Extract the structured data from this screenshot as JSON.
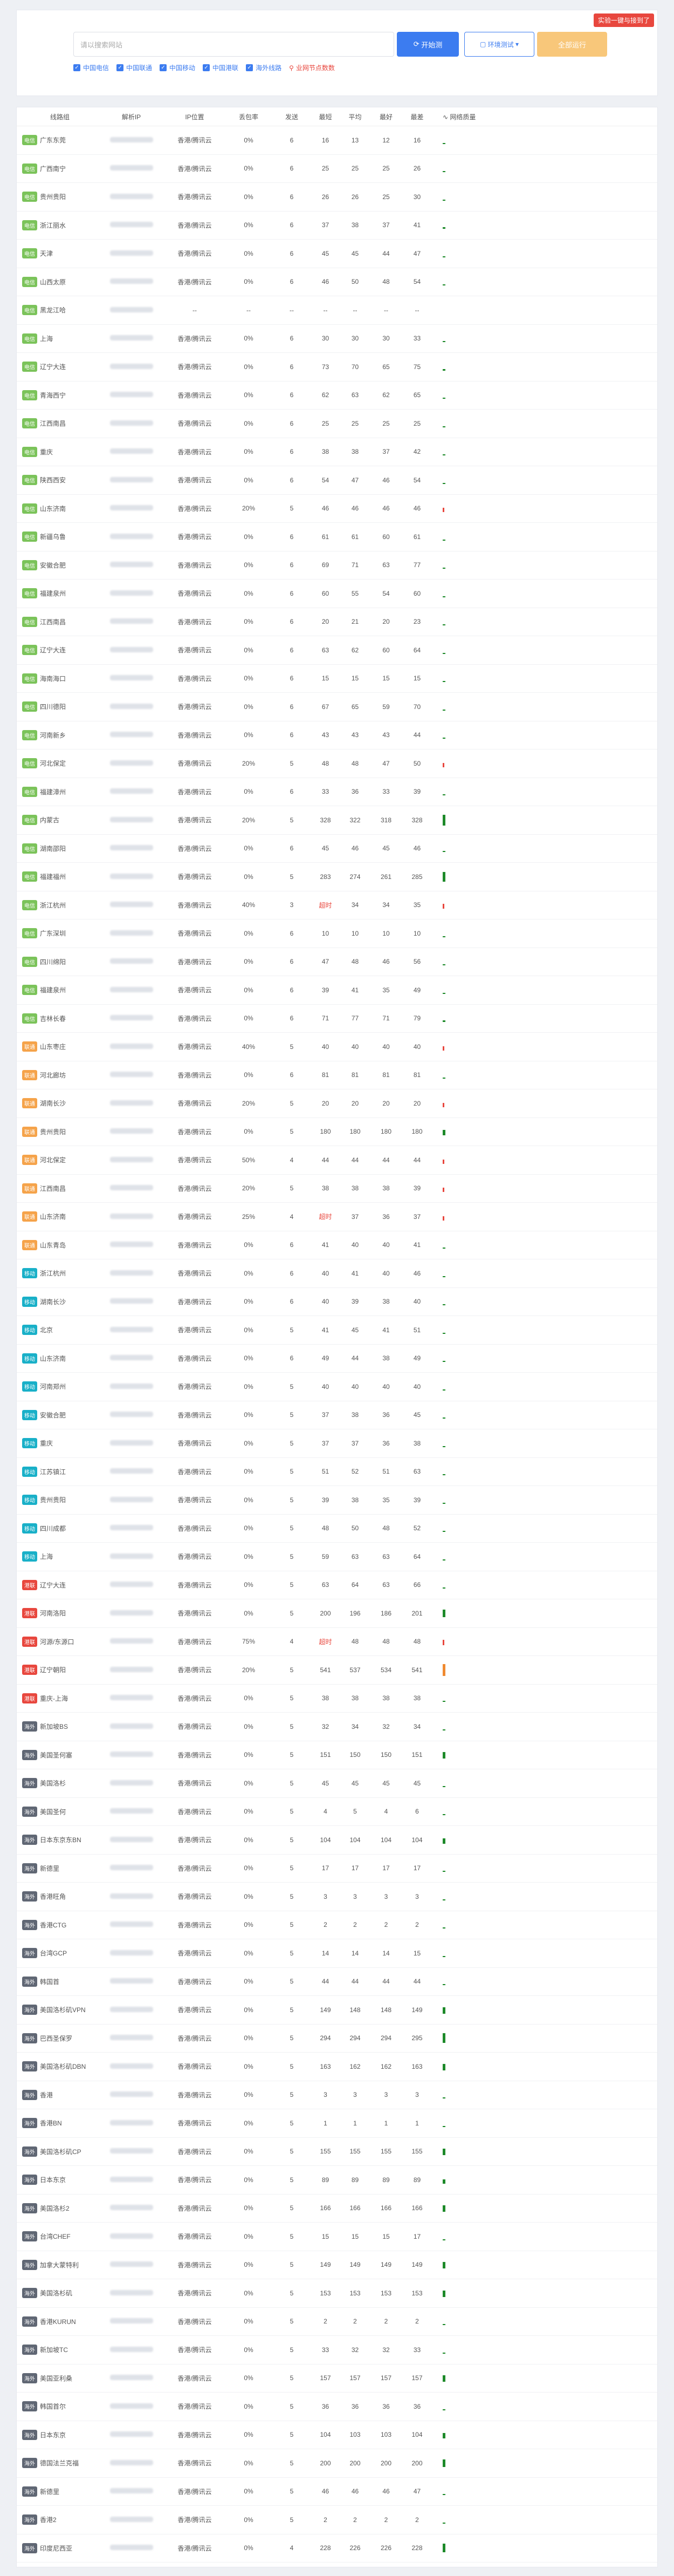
{
  "header": {
    "corner_badge": "实验一键与接到了",
    "search_placeholder": "请以搜索网站",
    "start_btn": "开始测",
    "env_btn": "环境测试",
    "stop_btn": "全部运行"
  },
  "filters": [
    "中国电信",
    "中国联通",
    "中国移动",
    "中国港联",
    "海外线路"
  ],
  "location_filter": "业网节点数数",
  "columns": [
    "线路组",
    "解析IP",
    "IP位置",
    "丢包率",
    "发送",
    "最短",
    "平均",
    "最好",
    "最差",
    "网络质量"
  ],
  "colors": {
    "green": "#7bc35a",
    "orange": "#f5a34a",
    "teal": "#19b0c8",
    "red": "#e8473e",
    "gray": "#606774"
  },
  "rows": [
    {
      "tag": "电信",
      "tc": "green",
      "name": "广东东莞",
      "loss": "0%",
      "s": "6",
      "a": "16",
      "b": "13",
      "c": "12",
      "d": "16",
      "q": 1
    },
    {
      "tag": "电信",
      "tc": "green",
      "name": "广西南宁",
      "loss": "0%",
      "s": "6",
      "a": "25",
      "b": "25",
      "c": "25",
      "d": "26",
      "q": 1
    },
    {
      "tag": "电信",
      "tc": "green",
      "name": "贵州贵阳",
      "loss": "0%",
      "s": "6",
      "a": "26",
      "b": "26",
      "c": "25",
      "d": "30",
      "q": 1
    },
    {
      "tag": "电信",
      "tc": "green",
      "name": "浙江丽水",
      "loss": "0%",
      "s": "6",
      "a": "37",
      "b": "38",
      "c": "37",
      "d": "41",
      "q": 3
    },
    {
      "tag": "电信",
      "tc": "green",
      "name": "天津",
      "loss": "0%",
      "s": "6",
      "a": "45",
      "b": "45",
      "c": "44",
      "d": "47",
      "q": 2
    },
    {
      "tag": "电信",
      "tc": "green",
      "name": "山西太原",
      "loss": "0%",
      "s": "6",
      "a": "46",
      "b": "50",
      "c": "48",
      "d": "54",
      "q": 2
    },
    {
      "tag": "电信",
      "tc": "green",
      "name": "黑龙江哈",
      "loss": "--",
      "s": "--",
      "a": "--",
      "b": "--",
      "c": "--",
      "d": "--",
      "q": 0
    },
    {
      "tag": "电信",
      "tc": "green",
      "name": "上海",
      "loss": "0%",
      "s": "6",
      "a": "30",
      "b": "30",
      "c": "30",
      "d": "33",
      "q": 1
    },
    {
      "tag": "电信",
      "tc": "green",
      "name": "辽宁大连",
      "loss": "0%",
      "s": "6",
      "a": "73",
      "b": "70",
      "c": "65",
      "d": "75",
      "q": 3
    },
    {
      "tag": "电信",
      "tc": "green",
      "name": "青海西宁",
      "loss": "0%",
      "s": "6",
      "a": "62",
      "b": "63",
      "c": "62",
      "d": "65",
      "q": 2
    },
    {
      "tag": "电信",
      "tc": "green",
      "name": "江西南昌",
      "loss": "0%",
      "s": "6",
      "a": "25",
      "b": "25",
      "c": "25",
      "d": "25",
      "q": 1
    },
    {
      "tag": "电信",
      "tc": "green",
      "name": "重庆",
      "loss": "0%",
      "s": "6",
      "a": "38",
      "b": "38",
      "c": "37",
      "d": "42",
      "q": 1
    },
    {
      "tag": "电信",
      "tc": "green",
      "name": "陕西西安",
      "loss": "0%",
      "s": "6",
      "a": "54",
      "b": "47",
      "c": "46",
      "d": "54",
      "q": 2
    },
    {
      "tag": "电信",
      "tc": "green",
      "name": "山东济南",
      "loss": "20%",
      "s": "5",
      "a": "46",
      "b": "46",
      "c": "46",
      "d": "46",
      "q": 8
    },
    {
      "tag": "电信",
      "tc": "green",
      "name": "新疆乌鲁",
      "loss": "0%",
      "s": "6",
      "a": "61",
      "b": "61",
      "c": "60",
      "d": "61",
      "q": 2
    },
    {
      "tag": "电信",
      "tc": "green",
      "name": "安徽合肥",
      "loss": "0%",
      "s": "6",
      "a": "69",
      "b": "71",
      "c": "63",
      "d": "77",
      "q": 2
    },
    {
      "tag": "电信",
      "tc": "green",
      "name": "福建泉州",
      "loss": "0%",
      "s": "6",
      "a": "60",
      "b": "55",
      "c": "54",
      "d": "60",
      "q": 1
    },
    {
      "tag": "电信",
      "tc": "green",
      "name": "江西南昌",
      "loss": "0%",
      "s": "6",
      "a": "20",
      "b": "21",
      "c": "20",
      "d": "23",
      "q": 1
    },
    {
      "tag": "电信",
      "tc": "green",
      "name": "辽宁大连",
      "loss": "0%",
      "s": "6",
      "a": "63",
      "b": "62",
      "c": "60",
      "d": "64",
      "q": 1
    },
    {
      "tag": "电信",
      "tc": "green",
      "name": "海南海口",
      "loss": "0%",
      "s": "6",
      "a": "15",
      "b": "15",
      "c": "15",
      "d": "15",
      "q": 1
    },
    {
      "tag": "电信",
      "tc": "green",
      "name": "四川德阳",
      "loss": "0%",
      "s": "6",
      "a": "67",
      "b": "65",
      "c": "59",
      "d": "70",
      "q": 2
    },
    {
      "tag": "电信",
      "tc": "green",
      "name": "河南新乡",
      "loss": "0%",
      "s": "6",
      "a": "43",
      "b": "43",
      "c": "43",
      "d": "44",
      "q": 1
    },
    {
      "tag": "电信",
      "tc": "green",
      "name": "河北保定",
      "loss": "20%",
      "s": "5",
      "a": "48",
      "b": "48",
      "c": "47",
      "d": "50",
      "q": 8
    },
    {
      "tag": "电信",
      "tc": "green",
      "name": "福建漳州",
      "loss": "0%",
      "s": "6",
      "a": "33",
      "b": "36",
      "c": "33",
      "d": "39",
      "q": 1
    },
    {
      "tag": "电信",
      "tc": "green",
      "name": "内蒙古",
      "loss": "20%",
      "s": "5",
      "a": "328",
      "b": "322",
      "c": "318",
      "d": "328",
      "q": 20
    },
    {
      "tag": "电信",
      "tc": "green",
      "name": "湖南邵阳",
      "loss": "0%",
      "s": "6",
      "a": "45",
      "b": "46",
      "c": "45",
      "d": "46",
      "q": 1
    },
    {
      "tag": "电信",
      "tc": "green",
      "name": "福建福州",
      "loss": "0%",
      "s": "5",
      "a": "283",
      "b": "274",
      "c": "261",
      "d": "285",
      "q": 18
    },
    {
      "tag": "电信",
      "tc": "green",
      "name": "浙江杭州",
      "loss": "40%",
      "s": "3",
      "a": "超时",
      "b": "34",
      "c": "34",
      "d": "35",
      "q": 9,
      "to": true
    },
    {
      "tag": "电信",
      "tc": "green",
      "name": "广东深圳",
      "loss": "0%",
      "s": "6",
      "a": "10",
      "b": "10",
      "c": "10",
      "d": "10",
      "q": 1
    },
    {
      "tag": "电信",
      "tc": "green",
      "name": "四川绵阳",
      "loss": "0%",
      "s": "6",
      "a": "47",
      "b": "48",
      "c": "46",
      "d": "56",
      "q": 2
    },
    {
      "tag": "电信",
      "tc": "green",
      "name": "福建泉州",
      "loss": "0%",
      "s": "6",
      "a": "39",
      "b": "41",
      "c": "35",
      "d": "49",
      "q": 2
    },
    {
      "tag": "电信",
      "tc": "green",
      "name": "吉林长春",
      "loss": "0%",
      "s": "6",
      "a": "71",
      "b": "77",
      "c": "71",
      "d": "79",
      "q": 3
    },
    {
      "tag": "联通",
      "tc": "orange",
      "name": "山东枣庄",
      "loss": "40%",
      "s": "5",
      "a": "40",
      "b": "40",
      "c": "40",
      "d": "40",
      "q": 8
    },
    {
      "tag": "联通",
      "tc": "orange",
      "name": "河北廊坊",
      "loss": "0%",
      "s": "6",
      "a": "81",
      "b": "81",
      "c": "81",
      "d": "81",
      "q": 2
    },
    {
      "tag": "联通",
      "tc": "orange",
      "name": "湖南长沙",
      "loss": "20%",
      "s": "5",
      "a": "20",
      "b": "20",
      "c": "20",
      "d": "20",
      "q": 8
    },
    {
      "tag": "联通",
      "tc": "orange",
      "name": "贵州贵阳",
      "loss": "0%",
      "s": "5",
      "a": "180",
      "b": "180",
      "c": "180",
      "d": "180",
      "q": 10
    },
    {
      "tag": "联通",
      "tc": "orange",
      "name": "河北保定",
      "loss": "50%",
      "s": "4",
      "a": "44",
      "b": "44",
      "c": "44",
      "d": "44",
      "q": 8
    },
    {
      "tag": "联通",
      "tc": "orange",
      "name": "江西南昌",
      "loss": "20%",
      "s": "5",
      "a": "38",
      "b": "38",
      "c": "38",
      "d": "39",
      "q": 8
    },
    {
      "tag": "联通",
      "tc": "orange",
      "name": "山东济南",
      "loss": "25%",
      "s": "4",
      "a": "超时",
      "b": "37",
      "c": "36",
      "d": "37",
      "q": 8,
      "to": true
    },
    {
      "tag": "联通",
      "tc": "orange",
      "name": "山东青岛",
      "loss": "0%",
      "s": "6",
      "a": "41",
      "b": "40",
      "c": "40",
      "d": "41",
      "q": 1
    },
    {
      "tag": "移动",
      "tc": "teal",
      "name": "浙江杭州",
      "loss": "0%",
      "s": "6",
      "a": "40",
      "b": "41",
      "c": "40",
      "d": "46",
      "q": 2
    },
    {
      "tag": "移动",
      "tc": "teal",
      "name": "湖南长沙",
      "loss": "0%",
      "s": "6",
      "a": "40",
      "b": "39",
      "c": "38",
      "d": "40",
      "q": 1
    },
    {
      "tag": "移动",
      "tc": "teal",
      "name": "北京",
      "loss": "0%",
      "s": "5",
      "a": "41",
      "b": "45",
      "c": "41",
      "d": "51",
      "q": 2
    },
    {
      "tag": "移动",
      "tc": "teal",
      "name": "山东济南",
      "loss": "0%",
      "s": "6",
      "a": "49",
      "b": "44",
      "c": "38",
      "d": "49",
      "q": 2
    },
    {
      "tag": "移动",
      "tc": "teal",
      "name": "河南郑州",
      "loss": "0%",
      "s": "5",
      "a": "40",
      "b": "40",
      "c": "40",
      "d": "40",
      "q": 1
    },
    {
      "tag": "移动",
      "tc": "teal",
      "name": "安徽合肥",
      "loss": "0%",
      "s": "5",
      "a": "37",
      "b": "38",
      "c": "36",
      "d": "45",
      "q": 2
    },
    {
      "tag": "移动",
      "tc": "teal",
      "name": "重庆",
      "loss": "0%",
      "s": "5",
      "a": "37",
      "b": "37",
      "c": "36",
      "d": "38",
      "q": 1
    },
    {
      "tag": "移动",
      "tc": "teal",
      "name": "江苏镇江",
      "loss": "0%",
      "s": "5",
      "a": "51",
      "b": "52",
      "c": "51",
      "d": "63",
      "q": 2
    },
    {
      "tag": "移动",
      "tc": "teal",
      "name": "贵州贵阳",
      "loss": "0%",
      "s": "5",
      "a": "39",
      "b": "38",
      "c": "35",
      "d": "39",
      "q": 1
    },
    {
      "tag": "移动",
      "tc": "teal",
      "name": "四川成都",
      "loss": "0%",
      "s": "5",
      "a": "48",
      "b": "50",
      "c": "48",
      "d": "52",
      "q": 2
    },
    {
      "tag": "移动",
      "tc": "teal",
      "name": "上海",
      "loss": "0%",
      "s": "5",
      "a": "59",
      "b": "63",
      "c": "63",
      "d": "64",
      "q": 2
    },
    {
      "tag": "港联",
      "tc": "red",
      "name": "辽宁大连",
      "loss": "0%",
      "s": "5",
      "a": "63",
      "b": "64",
      "c": "63",
      "d": "66",
      "q": 2
    },
    {
      "tag": "港联",
      "tc": "red",
      "name": "河南洛阳",
      "loss": "0%",
      "s": "5",
      "a": "200",
      "b": "196",
      "c": "186",
      "d": "201",
      "q": 14
    },
    {
      "tag": "港联",
      "tc": "red",
      "name": "河源/东源口",
      "loss": "75%",
      "s": "4",
      "a": "超时",
      "b": "48",
      "c": "48",
      "d": "48",
      "q": 10,
      "to": true
    },
    {
      "tag": "港联",
      "tc": "red",
      "name": "辽宁朝阳",
      "loss": "20%",
      "s": "5",
      "a": "541",
      "b": "537",
      "c": "534",
      "d": "541",
      "q": 22,
      "orange": true
    },
    {
      "tag": "港联",
      "tc": "red",
      "name": "重庆-上海",
      "loss": "0%",
      "s": "5",
      "a": "38",
      "b": "38",
      "c": "38",
      "d": "38",
      "q": 1
    },
    {
      "tag": "海外",
      "tc": "gray",
      "name": "新加坡BS",
      "loss": "0%",
      "s": "5",
      "a": "32",
      "b": "34",
      "c": "32",
      "d": "34",
      "q": 1
    },
    {
      "tag": "海外",
      "tc": "gray",
      "name": "美国圣何塞",
      "loss": "0%",
      "s": "5",
      "a": "151",
      "b": "150",
      "c": "150",
      "d": "151",
      "q": 12
    },
    {
      "tag": "海外",
      "tc": "gray",
      "name": "美国洛杉",
      "loss": "0%",
      "s": "5",
      "a": "45",
      "b": "45",
      "c": "45",
      "d": "45",
      "q": 2
    },
    {
      "tag": "海外",
      "tc": "gray",
      "name": "美国圣何",
      "loss": "0%",
      "s": "5",
      "a": "4",
      "b": "5",
      "c": "4",
      "d": "6",
      "q": 1
    },
    {
      "tag": "海外",
      "tc": "gray",
      "name": "日本东京东BN",
      "loss": "0%",
      "s": "5",
      "a": "104",
      "b": "104",
      "c": "104",
      "d": "104",
      "q": 10
    },
    {
      "tag": "海外",
      "tc": "gray",
      "name": "新德里",
      "loss": "0%",
      "s": "5",
      "a": "17",
      "b": "17",
      "c": "17",
      "d": "17",
      "q": 1
    },
    {
      "tag": "海外",
      "tc": "gray",
      "name": "香港旺角",
      "loss": "0%",
      "s": "5",
      "a": "3",
      "b": "3",
      "c": "3",
      "d": "3",
      "q": 1
    },
    {
      "tag": "海外",
      "tc": "gray",
      "name": "香港CTG",
      "loss": "0%",
      "s": "5",
      "a": "2",
      "b": "2",
      "c": "2",
      "d": "2",
      "q": 1
    },
    {
      "tag": "海外",
      "tc": "gray",
      "name": "台湾GCP",
      "loss": "0%",
      "s": "5",
      "a": "14",
      "b": "14",
      "c": "14",
      "d": "15",
      "q": 1
    },
    {
      "tag": "海外",
      "tc": "gray",
      "name": "韩国首",
      "loss": "0%",
      "s": "5",
      "a": "44",
      "b": "44",
      "c": "44",
      "d": "44",
      "q": 2
    },
    {
      "tag": "海外",
      "tc": "gray",
      "name": "美国洛杉矶VPN",
      "loss": "0%",
      "s": "5",
      "a": "149",
      "b": "148",
      "c": "148",
      "d": "149",
      "q": 12
    },
    {
      "tag": "海外",
      "tc": "gray",
      "name": "巴西圣保罗",
      "loss": "0%",
      "s": "5",
      "a": "294",
      "b": "294",
      "c": "294",
      "d": "295",
      "q": 18
    },
    {
      "tag": "海外",
      "tc": "gray",
      "name": "美国洛杉矶DBN",
      "loss": "0%",
      "s": "5",
      "a": "163",
      "b": "162",
      "c": "162",
      "d": "163",
      "q": 12
    },
    {
      "tag": "海外",
      "tc": "gray",
      "name": "香港",
      "loss": "0%",
      "s": "5",
      "a": "3",
      "b": "3",
      "c": "3",
      "d": "3",
      "q": 1
    },
    {
      "tag": "海外",
      "tc": "gray",
      "name": "香港BN",
      "loss": "0%",
      "s": "5",
      "a": "1",
      "b": "1",
      "c": "1",
      "d": "1",
      "q": 1
    },
    {
      "tag": "海外",
      "tc": "gray",
      "name": "美国洛杉矶CP",
      "loss": "0%",
      "s": "5",
      "a": "155",
      "b": "155",
      "c": "155",
      "d": "155",
      "q": 12
    },
    {
      "tag": "海外",
      "tc": "gray",
      "name": "日本东京",
      "loss": "0%",
      "s": "5",
      "a": "89",
      "b": "89",
      "c": "89",
      "d": "89",
      "q": 8
    },
    {
      "tag": "海外",
      "tc": "gray",
      "name": "美国洛杉2",
      "loss": "0%",
      "s": "5",
      "a": "166",
      "b": "166",
      "c": "166",
      "d": "166",
      "q": 12
    },
    {
      "tag": "海外",
      "tc": "gray",
      "name": "台湾CHEF",
      "loss": "0%",
      "s": "5",
      "a": "15",
      "b": "15",
      "c": "15",
      "d": "17",
      "q": 1
    },
    {
      "tag": "海外",
      "tc": "gray",
      "name": "加拿大蒙特利",
      "loss": "0%",
      "s": "5",
      "a": "149",
      "b": "149",
      "c": "149",
      "d": "149",
      "q": 12
    },
    {
      "tag": "海外",
      "tc": "gray",
      "name": "美国洛杉矶",
      "loss": "0%",
      "s": "5",
      "a": "153",
      "b": "153",
      "c": "153",
      "d": "153",
      "q": 12
    },
    {
      "tag": "海外",
      "tc": "gray",
      "name": "香港KURUN",
      "loss": "0%",
      "s": "5",
      "a": "2",
      "b": "2",
      "c": "2",
      "d": "2",
      "q": 1
    },
    {
      "tag": "海外",
      "tc": "gray",
      "name": "新加坡TC",
      "loss": "0%",
      "s": "5",
      "a": "33",
      "b": "32",
      "c": "32",
      "d": "33",
      "q": 1
    },
    {
      "tag": "海外",
      "tc": "gray",
      "name": "美国亚利桑",
      "loss": "0%",
      "s": "5",
      "a": "157",
      "b": "157",
      "c": "157",
      "d": "157",
      "q": 12
    },
    {
      "tag": "海外",
      "tc": "gray",
      "name": "韩国首尔",
      "loss": "0%",
      "s": "5",
      "a": "36",
      "b": "36",
      "c": "36",
      "d": "36",
      "q": 1
    },
    {
      "tag": "海外",
      "tc": "gray",
      "name": "日本东京",
      "loss": "0%",
      "s": "5",
      "a": "104",
      "b": "103",
      "c": "103",
      "d": "104",
      "q": 10
    },
    {
      "tag": "海外",
      "tc": "gray",
      "name": "德国法兰克福",
      "loss": "0%",
      "s": "5",
      "a": "200",
      "b": "200",
      "c": "200",
      "d": "200",
      "q": 14
    },
    {
      "tag": "海外",
      "tc": "gray",
      "name": "新德里",
      "loss": "0%",
      "s": "5",
      "a": "46",
      "b": "46",
      "c": "46",
      "d": "47",
      "q": 2
    },
    {
      "tag": "海外",
      "tc": "gray",
      "name": "香港2",
      "loss": "0%",
      "s": "5",
      "a": "2",
      "b": "2",
      "c": "2",
      "d": "2",
      "q": 1
    },
    {
      "tag": "海外",
      "tc": "gray",
      "name": "印度尼西亚",
      "loss": "0%",
      "s": "4",
      "a": "228",
      "b": "226",
      "c": "226",
      "d": "228",
      "q": 16
    }
  ],
  "ip_location_text": "香港/腾讯云"
}
